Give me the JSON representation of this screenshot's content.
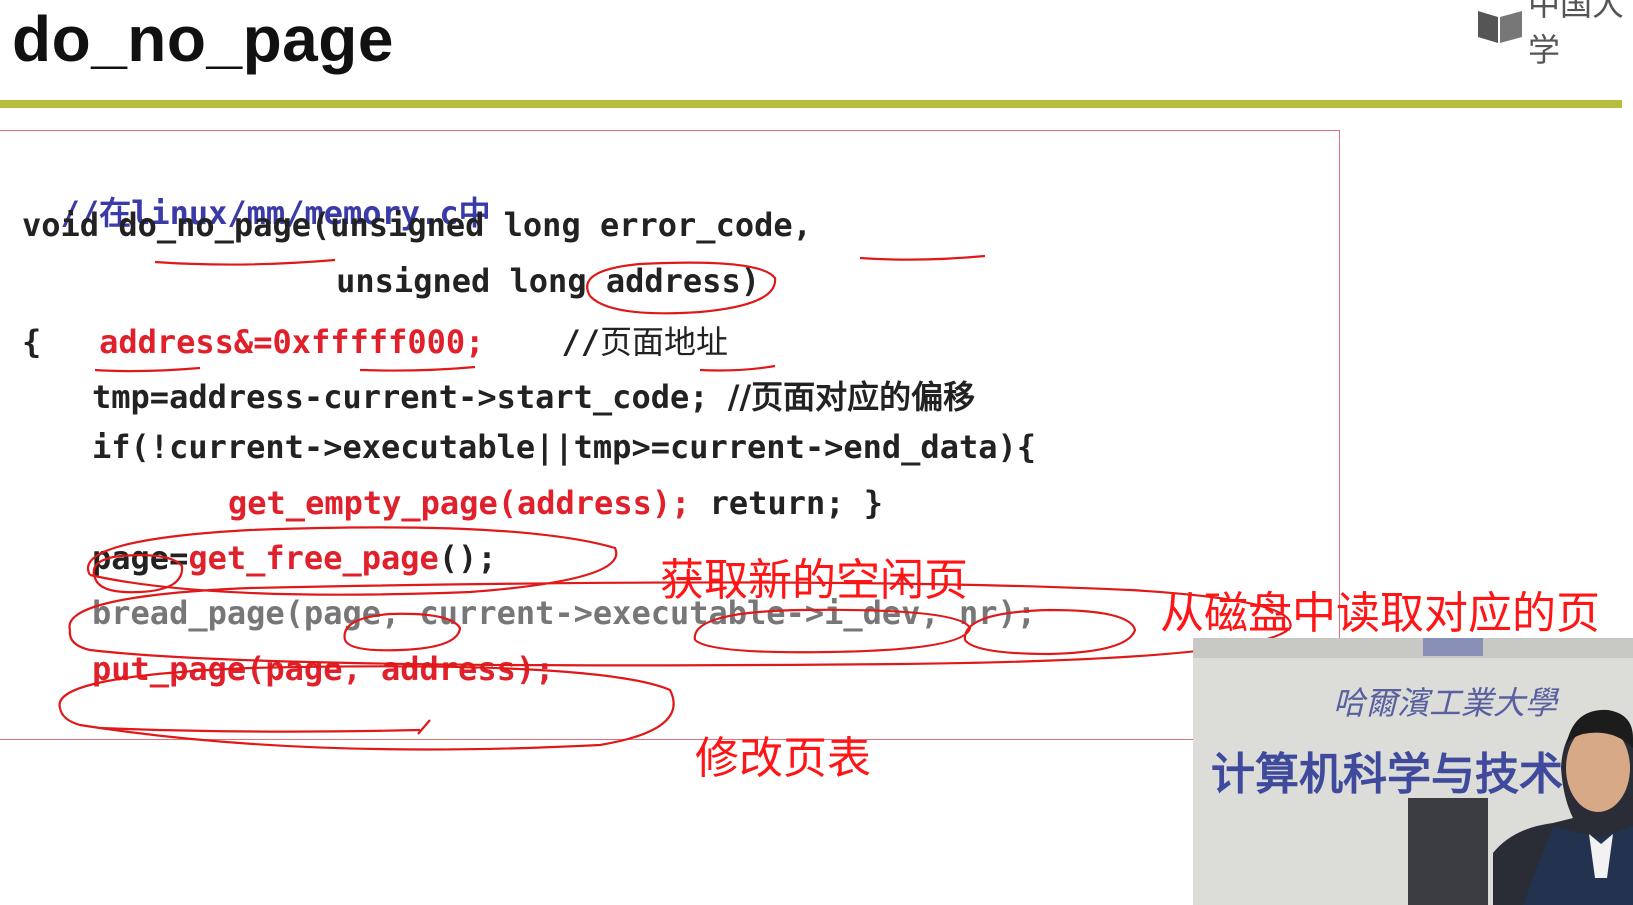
{
  "slide": {
    "title": "do_no_page",
    "logo_text": "中国大学"
  },
  "code": {
    "comment": "//在linux/mm/memory.c中",
    "line1": "void do_no_page(unsigned long error_code,",
    "line2": "        unsigned long address)",
    "line3_brace": "{",
    "line3_code": "address&=0xfffff000;",
    "line3_comment": "//页面地址",
    "line4": "tmp=address-current->start_code;",
    "line4_comment": "//页面对应的偏移",
    "line5": "if(!current->executable||tmp>=current->end_data){",
    "line6_code": "get_empty_page(address);",
    "line6_rest": " return; }",
    "line7_a": "page=",
    "line7_b": "get_free_page",
    "line7_c": "();",
    "line8": "bread_page(page, current->executable->i_dev, nr);",
    "line9": "put_page(page, address);"
  },
  "annotations": {
    "get_free": "获取新的空闲页",
    "read_disk": "从磁盘中读取对应的页",
    "modify_table": "修改页表"
  },
  "video": {
    "univ_name": "哈爾濱工業大學",
    "dept": "计算机科学与技术"
  },
  "colors": {
    "accent_rule": "#b5bd3c",
    "annotation_red": "#ff1515",
    "code_red": "#e0202a",
    "comment_blue": "#3a3aa8"
  }
}
